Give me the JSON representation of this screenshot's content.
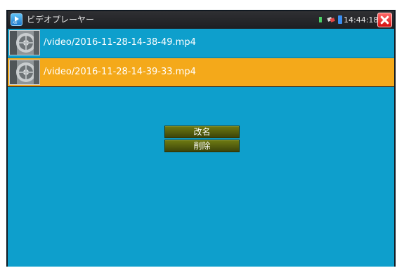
{
  "titlebar": {
    "title": "ビデオプレーヤー",
    "app_icon_text": "AVI",
    "clock": "14:44:18",
    "icons": [
      "app-icon",
      "sim-signal-icon",
      "network-icon",
      "battery-icon",
      "close-icon"
    ]
  },
  "files": [
    {
      "name": "/video/2016-11-28-14-38-49.mp4",
      "selected": false
    },
    {
      "name": "/video/2016-11-28-14-39-33.mp4",
      "selected": true
    }
  ],
  "context_menu": {
    "rename_label": "改名",
    "delete_label": "削除"
  },
  "colors": {
    "background": "#0e9fcc",
    "selected_row": "#f4a91a",
    "titlebar": "#2f3033",
    "menu_button": "#5a6410",
    "close_button": "#e01d1d"
  }
}
